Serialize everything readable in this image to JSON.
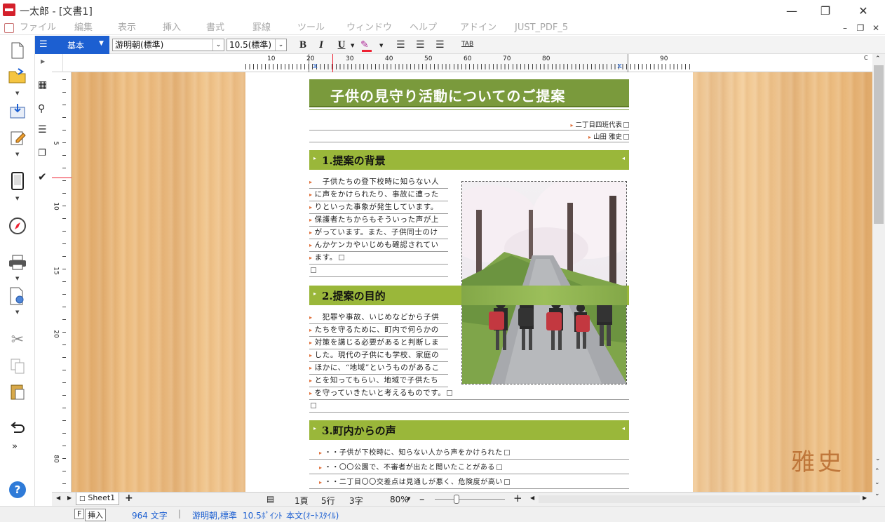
{
  "window": {
    "title": "一太郎 - [文書1]"
  },
  "menu": [
    "ファイル",
    "編集",
    "表示",
    "挿入",
    "書式",
    "罫線",
    "ツール",
    "ウィンドウ",
    "ヘルプ",
    "アドイン",
    "JUST_PDF_5"
  ],
  "toolbar": {
    "style": "基本",
    "font": "游明朝(標準)",
    "size": "10.5(標準)",
    "bold": "B",
    "italic": "I",
    "underline": "U",
    "tab": "TAB"
  },
  "ruler": {
    "h_ticks": [
      "10",
      "20",
      "30",
      "40",
      "50",
      "60",
      "70",
      "80",
      "90"
    ],
    "v_ticks": [
      "5",
      "10",
      "15",
      "20",
      "80"
    ]
  },
  "document": {
    "title": "子供の見守り活動についてのご提案",
    "author_org": "二丁目四班代表",
    "author_name": "山田 雅史",
    "h1": "1.提案の背景",
    "p1": [
      "　子供たちの登下校時に知らない人",
      "に声をかけられたり、事故に遭った",
      "りといった事象が発生しています。",
      "保護者たちからもそういった声が上",
      "がっています。また、子供同士のけ",
      "んかケンカやいじめも確認されてい",
      "ます。"
    ],
    "h2": "2.提案の目的",
    "p2": [
      "　犯罪や事故、いじめなどから子供",
      "たちを守るために、町内で何らかの",
      "対策を講じる必要があると判断しま",
      "した。現代の子供にも学校、家庭の",
      "ほかに、“地域”というものがあるこ",
      "とを知ってもらい、地域で子供たち",
      "を守っていきたいと考えるものです。"
    ],
    "h3": "3.町内からの声",
    "list": [
      "・・子供が下校時に、知らない人から声をかけられた",
      "・・〇〇公園で、不審者が出たと聞いたことがある",
      "・・二丁目〇〇交差点は見通しが悪く、危険度が高い"
    ]
  },
  "signature": "雅史",
  "sheet_tab": "Sheet1",
  "status": {
    "page": "1頁",
    "line": "5行",
    "col": "3字",
    "zoom": "80%",
    "mode_key": "F",
    "mode": "挿入",
    "chars": "964 文字",
    "font_info": "游明朝,標準",
    "size_info": "10.5ﾎﾟｲﾝﾄ",
    "style_info": "本文(ｵｰﾄｽﾀｲﾙ)"
  },
  "colors": {
    "accent": "#1c5fd1",
    "title_bar": "#7a9a3c",
    "heading_bar": "#9ab73a",
    "wood": "#eebd80"
  }
}
